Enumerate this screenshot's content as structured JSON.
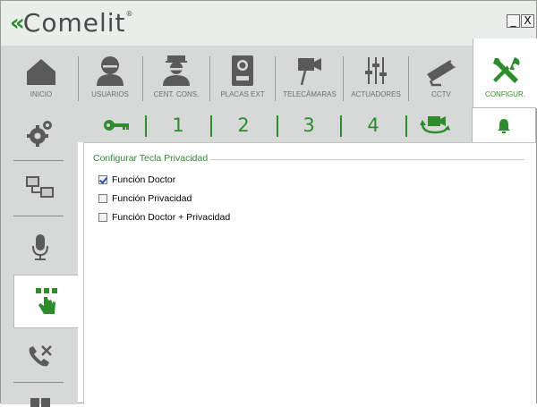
{
  "app": {
    "logo_mark": "«",
    "logo_text": "Comelit",
    "logo_reg": "®",
    "minimize": "_",
    "close": "X"
  },
  "main_nav": [
    {
      "label": "INICIO",
      "icon": "home-icon"
    },
    {
      "label": "USUARIOS",
      "icon": "user-icon"
    },
    {
      "label": "CENT. CONS.",
      "icon": "concierge-icon"
    },
    {
      "label": "PLACAS EXT",
      "icon": "entrance-panel-icon"
    },
    {
      "label": "TELECÁMARAS",
      "icon": "camera-icon"
    },
    {
      "label": "ACTUADORES",
      "icon": "actuator-icon"
    },
    {
      "label": "CCTV",
      "icon": "cctv-icon"
    },
    {
      "label": "CONFIGUR.",
      "icon": "tools-icon",
      "active": true
    }
  ],
  "sidebar": [
    {
      "icon": "gears-icon"
    },
    {
      "icon": "network-monitors-icon"
    },
    {
      "icon": "microphone-icon"
    },
    {
      "icon": "keypad-hand-icon",
      "active": true
    },
    {
      "icon": "phone-tools-icon"
    }
  ],
  "sub_tabs": [
    {
      "label": "",
      "icon": "key-icon"
    },
    {
      "label": "1"
    },
    {
      "label": "2"
    },
    {
      "label": "3"
    },
    {
      "label": "4"
    },
    {
      "label": "",
      "icon": "camera-cycle-icon"
    },
    {
      "label": "",
      "icon": "bell-icon",
      "active": true
    }
  ],
  "content": {
    "group_title": "Configurar Tecla Privacidad",
    "options": [
      {
        "label": "Función Doctor",
        "checked": true
      },
      {
        "label": "Función Privacidad",
        "checked": false
      },
      {
        "label": "Función Doctor + Privacidad",
        "checked": false
      }
    ]
  },
  "colors": {
    "accent": "#2e8b2e",
    "nav_bg": "#d7d9d8",
    "icon_gray": "#5a5a5a"
  }
}
